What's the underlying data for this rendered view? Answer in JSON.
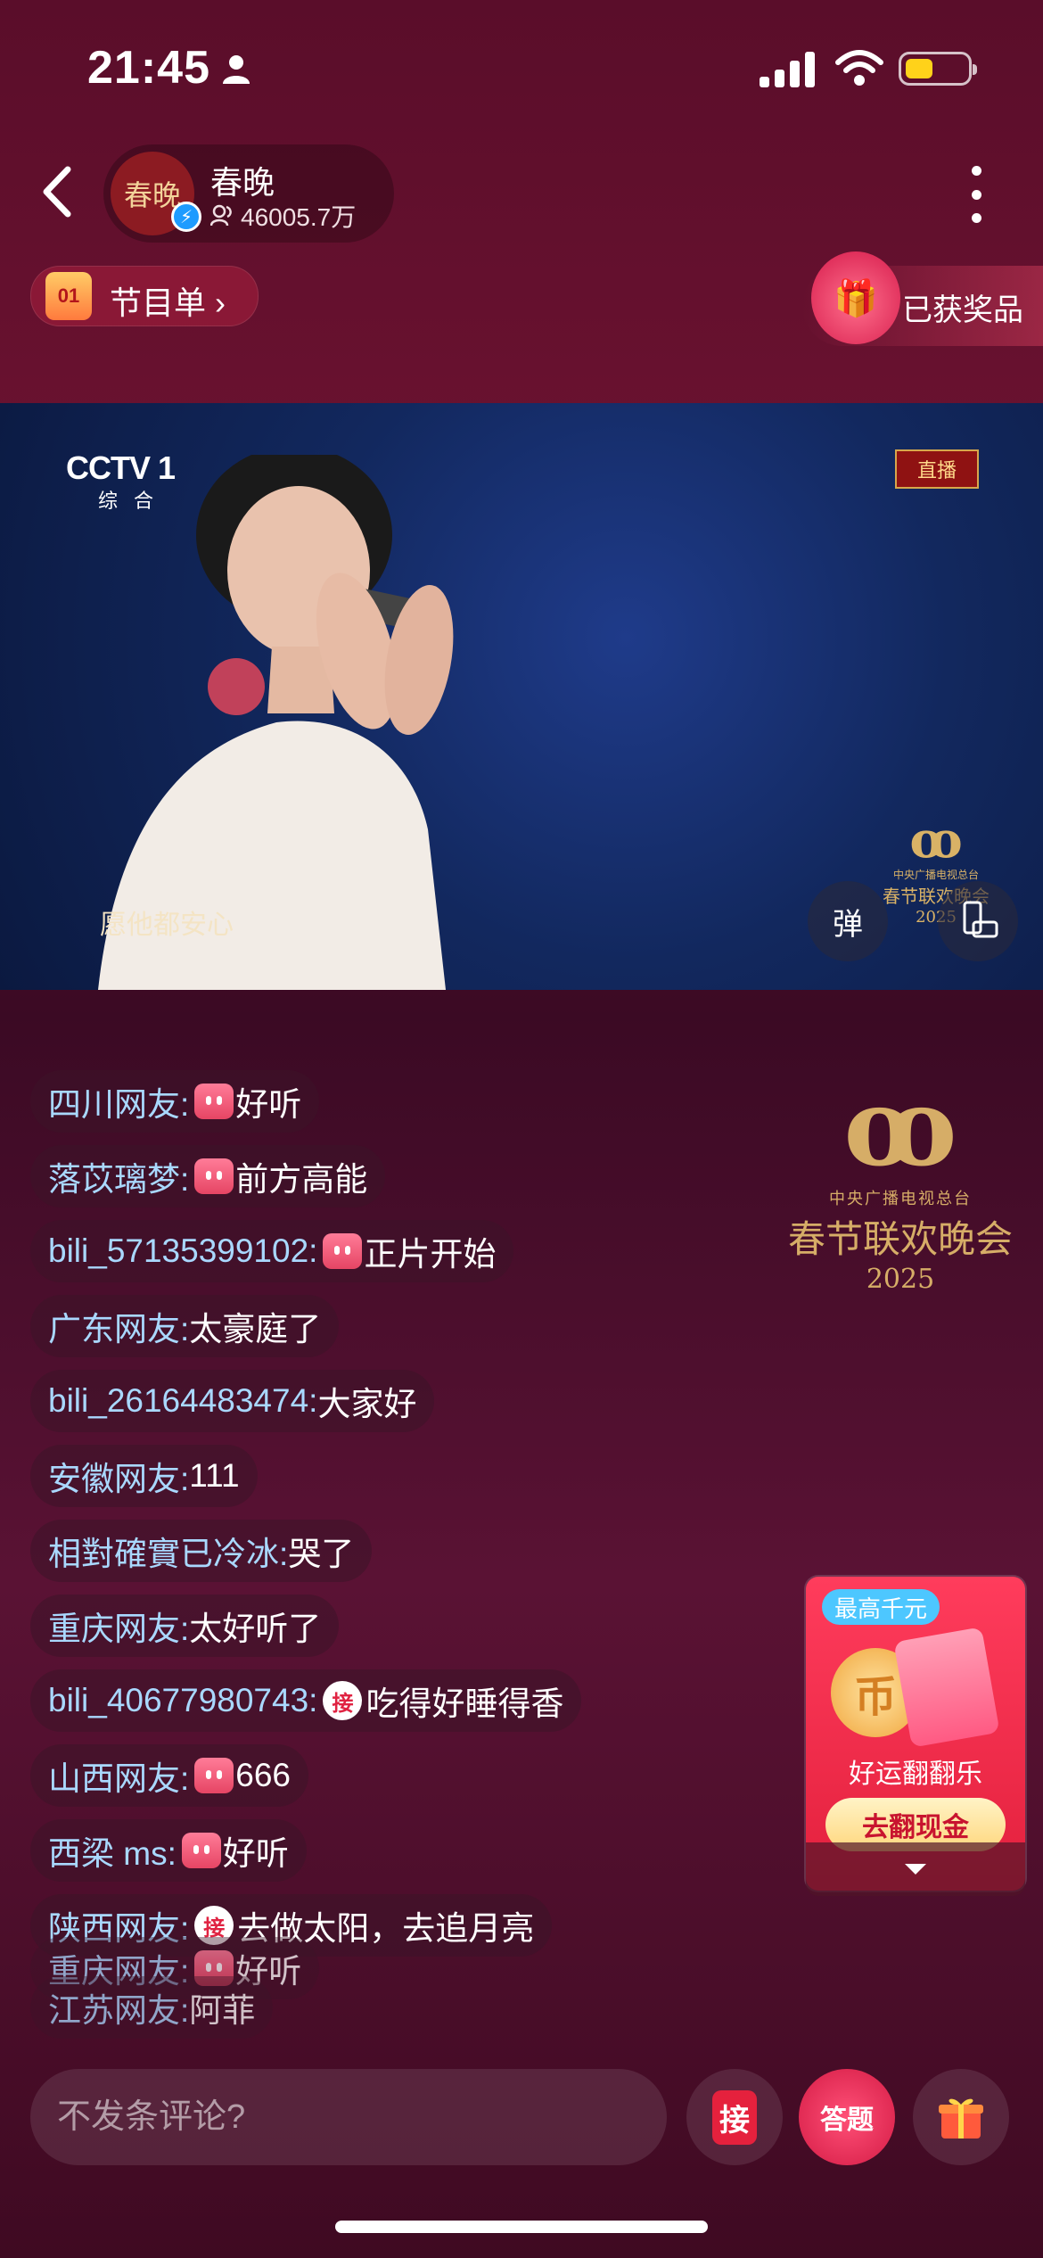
{
  "status_bar": {
    "time": "21:45"
  },
  "header": {
    "channel_avatar_text": "春晚",
    "channel_name": "春晚",
    "viewer_count": "46005.7万",
    "program_list_label": "节目单",
    "program_icon_text": "01",
    "prizes_label": "已获奖品"
  },
  "video": {
    "channel_logo": "CCTV 1",
    "channel_sub": "综合",
    "live_tag": "直播",
    "subtitle": "愿他都安心",
    "logo_small_line1": "中央广播电视总台",
    "logo_small_line2": "春节联欢晚会",
    "logo_small_year": "2025",
    "danmu_button": "弹"
  },
  "gala_logo": {
    "line1": "中央广播电视总台",
    "line2": "春节联欢晚会",
    "line3": "2025"
  },
  "comments": [
    {
      "user": "四川网友:",
      "badge": "b",
      "text": "好听"
    },
    {
      "user": "落苡璃梦:",
      "badge": "b",
      "text": "前方高能"
    },
    {
      "user": "bili_57135399102:",
      "badge": "b",
      "text": "正片开始"
    },
    {
      "user": "广东网友:",
      "badge": "",
      "text": "太豪庭了"
    },
    {
      "user": "bili_26164483474:",
      "badge": "",
      "text": "大家好"
    },
    {
      "user": "安徽网友:",
      "badge": "",
      "text": "111"
    },
    {
      "user": "相對確實已冷冰:",
      "badge": "",
      "text": "哭了"
    },
    {
      "user": "重庆网友:",
      "badge": "",
      "text": "太好听了"
    },
    {
      "user": "bili_40677980743:",
      "badge": "接",
      "text": "吃得好睡得香"
    },
    {
      "user": "山西网友:",
      "badge": "b",
      "text": "666"
    },
    {
      "user": "西梁 ms:",
      "badge": "b",
      "text": "好听"
    },
    {
      "user": "陕西网友:",
      "badge": "接",
      "text": "去做太阳，去追月亮"
    },
    {
      "user": "重庆网友:",
      "badge": "b",
      "text": "好听"
    },
    {
      "user": "江苏网友:",
      "badge": "",
      "text": "阿菲"
    }
  ],
  "promo": {
    "tag": "最高千元",
    "title": "好运翻翻乐",
    "button": "去翻现金"
  },
  "bottom_bar": {
    "comment_placeholder": "不发条评论?",
    "jie_label": "接",
    "answer_label": "答题"
  },
  "colors": {
    "username": "#a9d8ff",
    "accent_red": "#e3203d",
    "gold": "#d6ad67"
  }
}
